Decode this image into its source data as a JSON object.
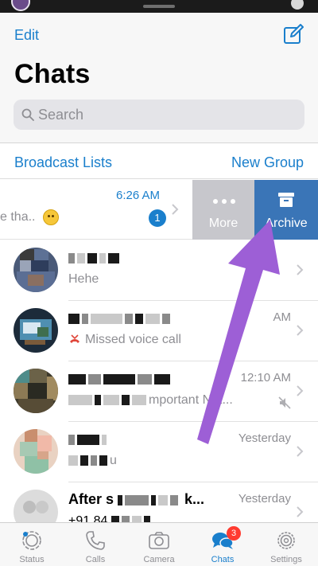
{
  "nav": {
    "edit_label": "Edit",
    "compose_icon": "compose-icon",
    "title": "Chats",
    "search_placeholder": "Search"
  },
  "links": {
    "broadcast_label": "Broadcast Lists",
    "new_group_label": "New Group"
  },
  "swiped_chat": {
    "preview_fragment": "e tha..",
    "time": "6:26 AM",
    "unread_count": "1",
    "actions": [
      {
        "label": "More",
        "icon": "more-dots-icon"
      },
      {
        "label": "Archive",
        "icon": "archive-icon"
      }
    ]
  },
  "chats": [
    {
      "name": "",
      "time": "",
      "preview": "Hehe"
    },
    {
      "name": "",
      "time": "AM",
      "preview": "Missed voice call"
    },
    {
      "name": "",
      "time": "12:10 AM",
      "preview": "mportant Not..."
    },
    {
      "name": "",
      "time": "Yesterday",
      "preview": "u"
    },
    {
      "name": "After s",
      "name_tail": "k...",
      "time": "Yesterday",
      "preview": "+91 84"
    }
  ],
  "tabs": [
    {
      "label": "Status",
      "icon": "status-icon",
      "active": false
    },
    {
      "label": "Calls",
      "icon": "phone-icon",
      "active": false
    },
    {
      "label": "Camera",
      "icon": "camera-icon",
      "active": false
    },
    {
      "label": "Chats",
      "icon": "chats-icon",
      "active": true,
      "badge": "3"
    },
    {
      "label": "Settings",
      "icon": "gear-icon",
      "active": false
    }
  ],
  "colors": {
    "accent": "#1a7fcc",
    "archive_action": "#3a75b7",
    "more_action": "#c7c7cc",
    "annotation_arrow": "#9d5fd6",
    "badge_red": "#ff3b30"
  }
}
